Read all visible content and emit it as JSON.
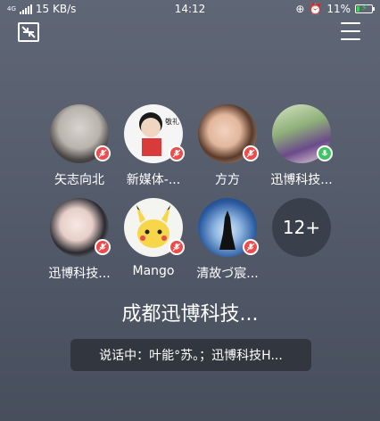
{
  "status_bar": {
    "network": "4G",
    "speed": "15 KB/s",
    "time": "14:12",
    "battery": "11%",
    "battery_color": "#39d353"
  },
  "toolbar": {
    "collapse_icon": "collapse-arrows-icon",
    "menu_icon": "hamburger-menu-icon"
  },
  "members": [
    {
      "name": "矢志向北",
      "mic": "muted"
    },
    {
      "name": "新媒体-...",
      "mic": "muted"
    },
    {
      "name": "方方",
      "mic": "muted"
    },
    {
      "name": "迅博科技...",
      "mic": "on"
    },
    {
      "name": "迅博科技...",
      "mic": "muted"
    },
    {
      "name": "Mango",
      "mic": "muted"
    },
    {
      "name": "清故づ宸...",
      "mic": "muted"
    }
  ],
  "more_count": "12+",
  "room_title": "成都迅博科技...",
  "speaking": "说话中：叶能°苏。；迅博科技H...",
  "colors": {
    "muted_badge": "#ef4b4b",
    "active_badge": "#3fc463",
    "background": "#565d6d"
  }
}
